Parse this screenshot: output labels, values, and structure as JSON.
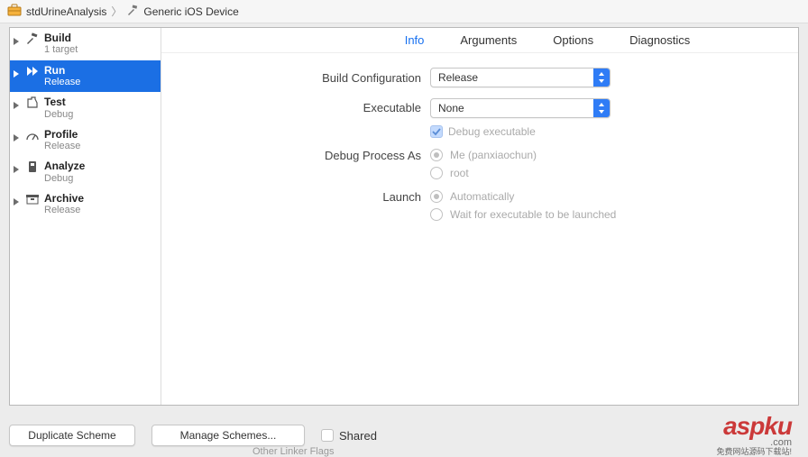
{
  "breadcrumb": {
    "project": "stdUrineAnalysis",
    "target": "Generic iOS Device"
  },
  "sidebar": {
    "items": [
      {
        "title": "Build",
        "sub": "1 target"
      },
      {
        "title": "Run",
        "sub": "Release"
      },
      {
        "title": "Test",
        "sub": "Debug"
      },
      {
        "title": "Profile",
        "sub": "Release"
      },
      {
        "title": "Analyze",
        "sub": "Debug"
      },
      {
        "title": "Archive",
        "sub": "Release"
      }
    ],
    "selected_index": 1
  },
  "tabs": {
    "items": [
      "Info",
      "Arguments",
      "Options",
      "Diagnostics"
    ],
    "active_index": 0
  },
  "form": {
    "build_config": {
      "label": "Build Configuration",
      "value": "Release"
    },
    "executable": {
      "label": "Executable",
      "value": "None"
    },
    "debug_exec": {
      "label": "Debug executable",
      "checked": true,
      "disabled": true
    },
    "debug_process": {
      "label": "Debug Process As",
      "options": [
        {
          "label": "Me (panxiaochun)",
          "checked": true
        },
        {
          "label": "root",
          "checked": false
        }
      ]
    },
    "launch": {
      "label": "Launch",
      "options": [
        {
          "label": "Automatically",
          "checked": true
        },
        {
          "label": "Wait for executable to be launched",
          "checked": false
        }
      ]
    }
  },
  "bottom": {
    "duplicate": "Duplicate Scheme",
    "manage": "Manage Schemes...",
    "shared": "Shared",
    "shared_checked": false
  },
  "watermark": {
    "brand": "aspku",
    "tld": ".com",
    "tagline": "免费网站源码下载站!"
  },
  "footer_stray": "Other Linker Flags"
}
